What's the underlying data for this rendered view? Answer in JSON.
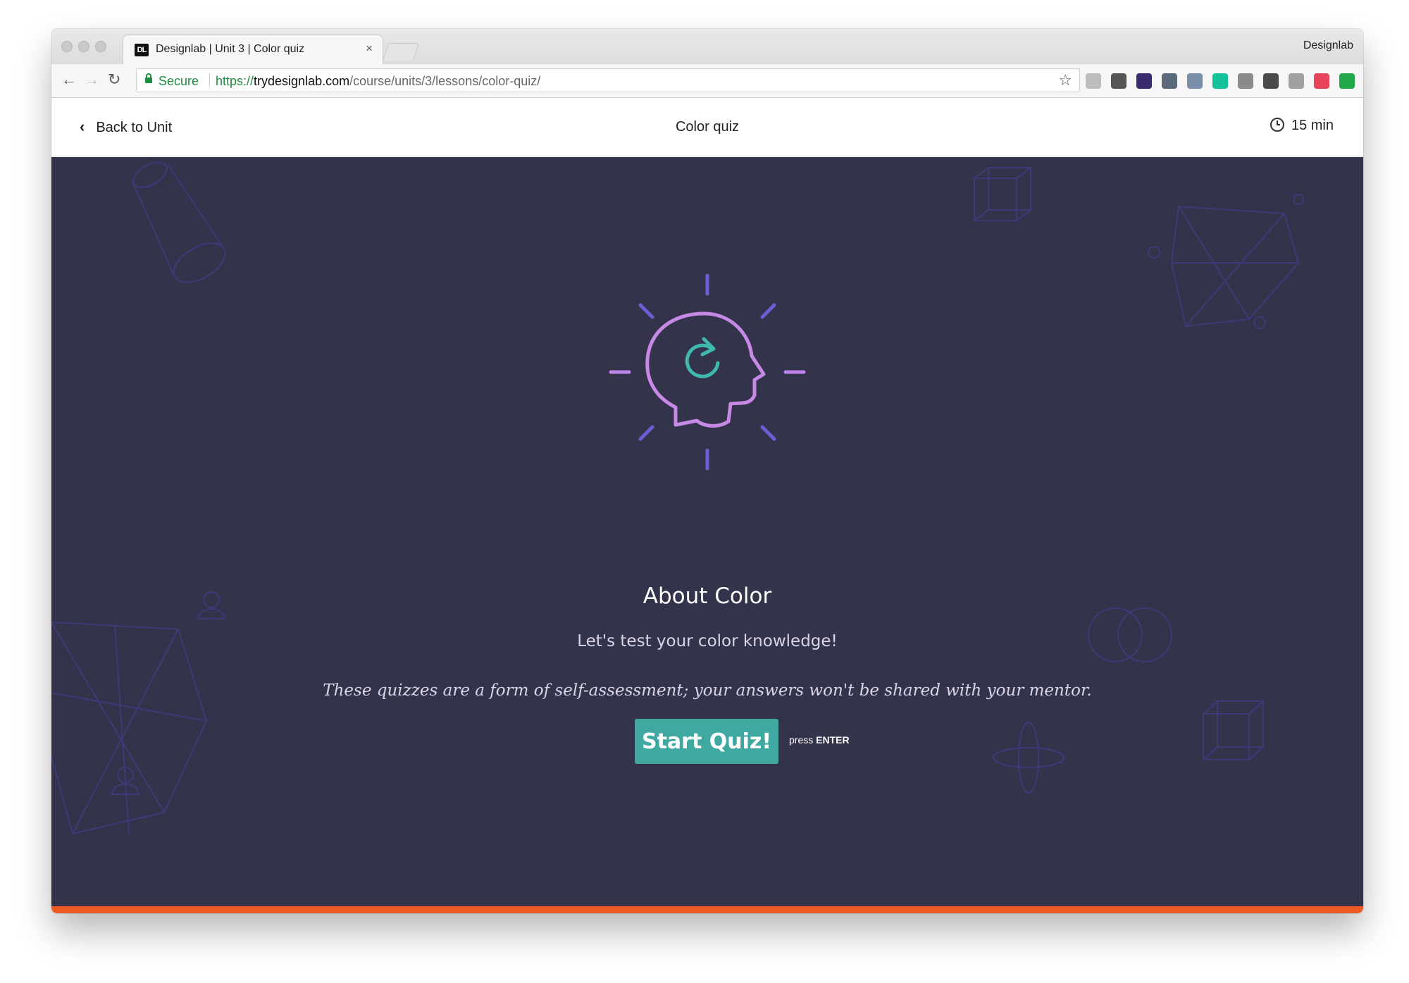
{
  "browser": {
    "tab_title": "Designlab | Unit 3 | Color quiz",
    "tab_favicon_text": "DL",
    "tab_close": "×",
    "profile_name": "Designlab",
    "secure_label": "Secure",
    "url_protocol": "https://",
    "url_host": "trydesignlab.com",
    "url_path": "/course/units/3/lessons/color-quiz/",
    "back_glyph": "←",
    "forward_glyph": "→",
    "reload_glyph": "↻",
    "bookmark_glyph": "☆",
    "extensions": [
      {
        "icon": "cloud-extension-icon",
        "color": "#bdbdbd"
      },
      {
        "icon": "hexagon-extension-icon",
        "color": "#555555"
      },
      {
        "icon": "color-picker-extension-icon",
        "color": "#3a2a6e"
      },
      {
        "icon": "dots-extension-icon",
        "color": "#5b6a7a"
      },
      {
        "icon": "screen-extension-icon",
        "color": "#7c8fa8"
      },
      {
        "icon": "grammarly-extension-icon",
        "color": "#15c39a"
      },
      {
        "icon": "eye-extension-icon",
        "color": "#8a8a8a"
      },
      {
        "icon": "m-extension-icon",
        "color": "#4a4a4a"
      },
      {
        "icon": "camera-extension-icon",
        "color": "#a0a0a0"
      },
      {
        "icon": "rainbow-extension-icon",
        "color": "#e8455c"
      },
      {
        "icon": "upload-extension-icon",
        "color": "#21a84a"
      }
    ]
  },
  "header": {
    "back_label": "Back to Unit",
    "back_chevron": "‹",
    "title": "Color quiz",
    "duration": "15 min"
  },
  "hero": {
    "title": "About Color",
    "subtitle": "Let's test your color knowledge!",
    "disclaimer": "These quizzes are a form of self-assessment; your answers won't be shared with your mentor.",
    "start_button": "Start Quiz!",
    "press_prefix": "press",
    "press_key": "ENTER"
  },
  "colors": {
    "hero_bg": "#34334c",
    "button": "#3fa8a0",
    "bottom_bar": "#ec5a22",
    "ray_purple": "#6b5fd6",
    "ray_lilac": "#c084e8",
    "head_outline": "#c689e6",
    "refresh_teal": "#3fb8ad"
  }
}
